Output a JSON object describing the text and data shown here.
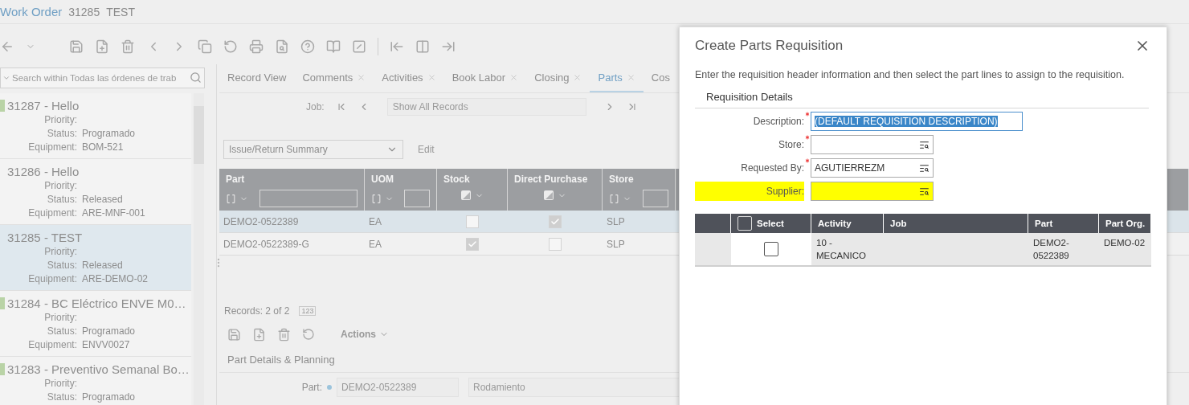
{
  "header": {
    "module": "Work Order",
    "number": "31285",
    "title": "TEST"
  },
  "sidebar": {
    "search": {
      "placeholder": "Search within Todas las órdenes de trab"
    },
    "items": [
      {
        "title": "31287 - Hello",
        "tagged": true,
        "selected": false,
        "fields": [
          {
            "label": "Priority:"
          },
          {
            "label": "Status:",
            "value": "Programado"
          },
          {
            "label": "Equipment:",
            "value": "BOM-521"
          }
        ]
      },
      {
        "title": "31286 - Hello",
        "tagged": false,
        "selected": false,
        "fields": [
          {
            "label": "Priority:"
          },
          {
            "label": "Status:",
            "value": "Released"
          },
          {
            "label": "Equipment:",
            "value": "ARE-MNF-001"
          }
        ]
      },
      {
        "title": "31285 - TEST",
        "tagged": false,
        "selected": true,
        "fields": [
          {
            "label": "Priority:"
          },
          {
            "label": "Status:",
            "value": "Released"
          },
          {
            "label": "Equipment:",
            "value": "ARE-DEMO-02"
          }
        ]
      },
      {
        "title": "31284 - BC Eléctrico ENVE M0…",
        "tagged": true,
        "selected": false,
        "fields": [
          {
            "label": "Priority:"
          },
          {
            "label": "Status:",
            "value": "Programado"
          },
          {
            "label": "Equipment:",
            "value": "ENVV0027"
          }
        ]
      },
      {
        "title": "31283 - Preventivo Semanal Bo…",
        "tagged": true,
        "selected": false,
        "fields": [
          {
            "label": "Priority:"
          },
          {
            "label": "Status:",
            "value": "Programado"
          }
        ]
      }
    ]
  },
  "tabs": [
    {
      "label": "Record View",
      "closable": false,
      "selected": false
    },
    {
      "label": "Comments",
      "closable": true,
      "selected": false
    },
    {
      "label": "Activities",
      "closable": true,
      "selected": false
    },
    {
      "label": "Book Labor",
      "closable": true,
      "selected": false
    },
    {
      "label": "Closing",
      "closable": true,
      "selected": false
    },
    {
      "label": "Parts",
      "closable": true,
      "selected": true
    },
    {
      "label": "Cos",
      "closable": false,
      "selected": false
    }
  ],
  "job_nav": {
    "label": "Job:",
    "placeholder": "Show All Records"
  },
  "grid_view": {
    "value": "Issue/Return Summary",
    "edit": "Edit"
  },
  "table": {
    "columns": [
      {
        "label": "Part",
        "kind": "text"
      },
      {
        "label": "UOM",
        "kind": "text"
      },
      {
        "label": "Stock",
        "kind": "check"
      },
      {
        "label": "Direct Purchase",
        "kind": "check"
      },
      {
        "label": "Store",
        "kind": "text"
      }
    ],
    "rows": [
      {
        "selected": true,
        "part": "DEMO2-0522389",
        "uom": "EA",
        "stock": false,
        "direct_purchase": true,
        "store": "SLP"
      },
      {
        "selected": false,
        "part": "DEMO2-0522389-G",
        "uom": "EA",
        "stock": true,
        "direct_purchase": false,
        "store": "SLP"
      }
    ]
  },
  "records": {
    "text": "Records: 2 of 2",
    "badge": "123"
  },
  "actions": {
    "label": "Actions"
  },
  "details": {
    "title": "Part Details & Planning",
    "fields": [
      {
        "label": "Part:",
        "value": "DEMO2-0522389",
        "description": "Rodamiento"
      }
    ]
  },
  "dialog": {
    "title": "Create Parts Requisition",
    "intro": "Enter the requisition header information and then select the part lines to assign to the requisition.",
    "section": "Requisition Details",
    "fields": [
      {
        "label": "Description:",
        "required": true,
        "value": "(DEFAULT REQUISITION DESCRIPTION)",
        "kind": "text",
        "selected": true,
        "highlighted": false
      },
      {
        "label": "Store:",
        "required": true,
        "kind": "lookup",
        "selected": false,
        "highlighted": false
      },
      {
        "label": "Requested By:",
        "required": true,
        "value": "AGUTIERREZM",
        "kind": "lookup",
        "selected": false,
        "highlighted": false
      },
      {
        "label": "Supplier:",
        "required": false,
        "kind": "lookup",
        "selected": false,
        "highlighted": true
      }
    ],
    "table": {
      "columns": [
        "Select",
        "Activity",
        "Job",
        "Part",
        "Part Org."
      ],
      "all_checked": false,
      "rows": [
        {
          "checked": false,
          "activity": "10 - MECANICO",
          "part": "DEMO2-0522389",
          "part_org": "DEMO-02"
        }
      ]
    }
  }
}
